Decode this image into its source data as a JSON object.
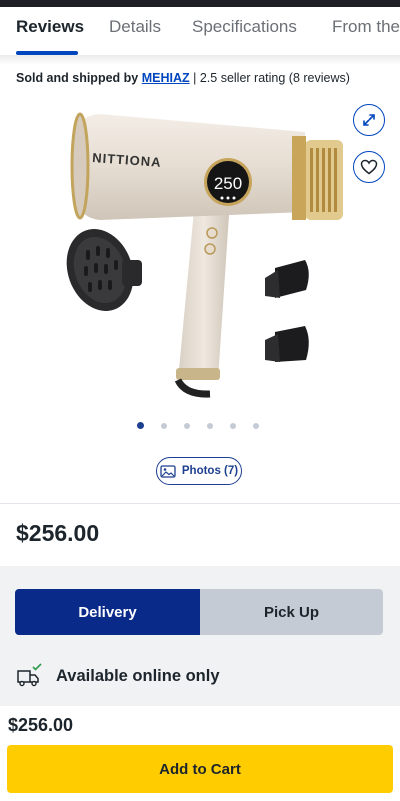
{
  "tabs": [
    {
      "label": "Reviews"
    },
    {
      "label": "Details"
    },
    {
      "label": "Specifications"
    },
    {
      "label": "From the"
    }
  ],
  "seller": {
    "prefix": "Sold and shipped by",
    "name": "MEHIAZ",
    "rating_text": "| 2.5 seller rating (8 reviews)"
  },
  "product": {
    "brand_text": "NITTIONA",
    "display_value": "250",
    "image_count": 6,
    "active_image": 1
  },
  "photos_button": {
    "label": "Photos (7)"
  },
  "price": "$256.00",
  "fulfillment": {
    "delivery_label": "Delivery",
    "pickup_label": "Pick Up",
    "selected": "Delivery"
  },
  "availability": {
    "text": "Available online only"
  },
  "bottom_bar": {
    "price": "$256.00",
    "cart_label": "Add to Cart"
  },
  "colors": {
    "primary_blue": "#0046be",
    "cart_yellow": "#ffcc00",
    "delivery_navy": "#0a2a8a"
  }
}
